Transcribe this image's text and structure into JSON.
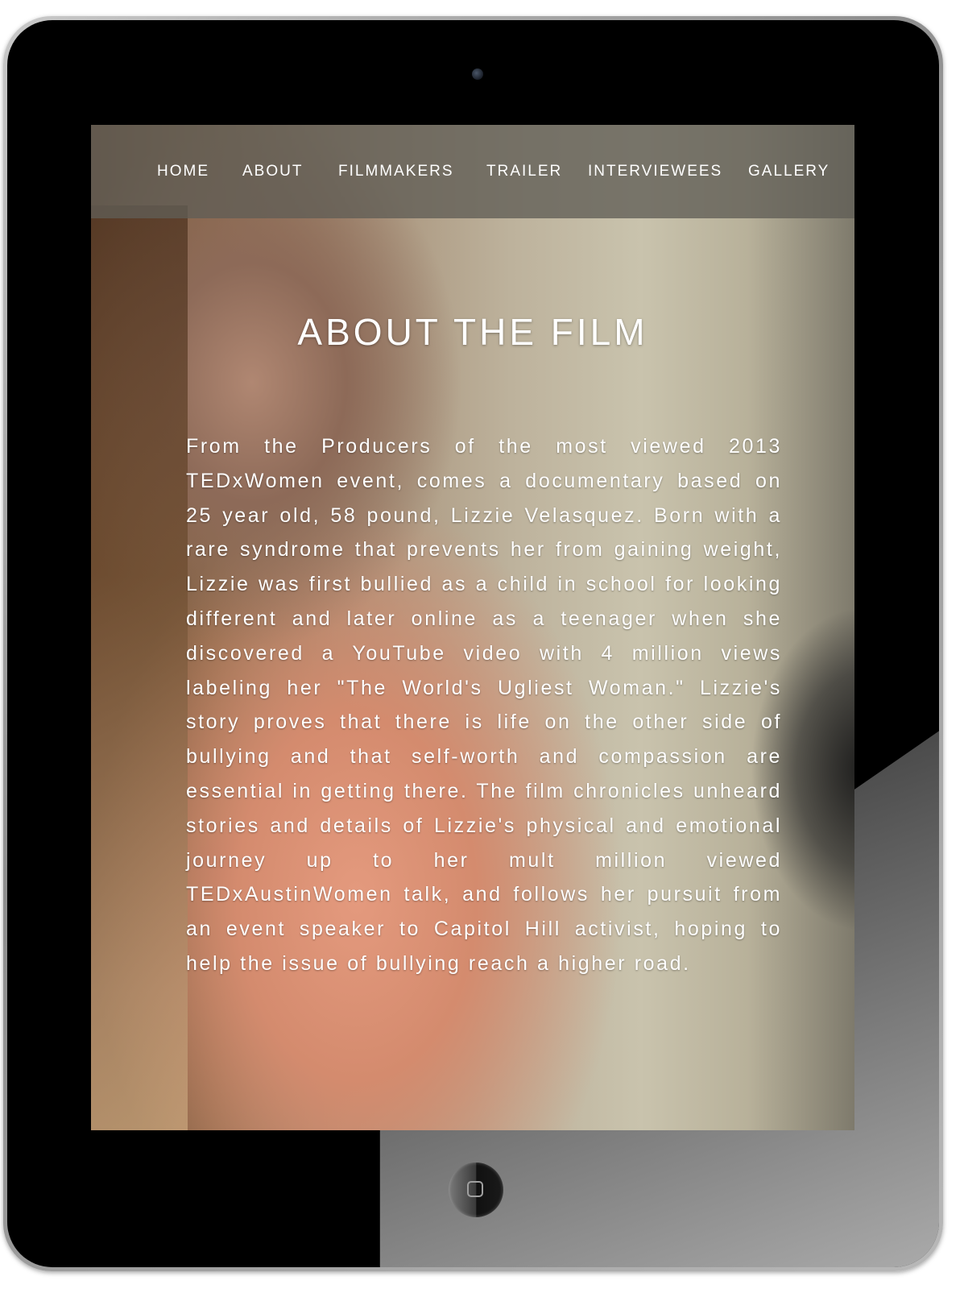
{
  "nav": {
    "items": [
      {
        "label": "HOME"
      },
      {
        "label": "ABOUT"
      },
      {
        "label": "FILMMAKERS"
      },
      {
        "label": "TRAILER"
      },
      {
        "label": "INTERVIEWEES"
      },
      {
        "label": "GALLERY"
      }
    ]
  },
  "main": {
    "title": "ABOUT THE FILM",
    "body": "From the Producers of the most viewed 2013 TEDxWomen event, comes a documentary based on 25 year old, 58 pound, Lizzie Velasquez. Born with a rare syndrome that prevents her from gaining weight, Lizzie was first bullied as a child in school for looking different and later online as a teenager when she discovered a YouTube video with 4 million views labeling her \"The World's Ugliest Woman.\" Lizzie's story proves that there is life on the other side of bullying and that self-worth and compassion are essential in getting there. The film chronicles unheard stories and details of Lizzie's physical and emotional journey up to her mult million viewed TEDxAustinWomen talk, and follows her pursuit from an event speaker to Capitol Hill activist, hoping to help the issue of bullying reach a higher road."
  },
  "device": {
    "icons": [
      "front-camera-icon",
      "home-button-icon"
    ]
  }
}
